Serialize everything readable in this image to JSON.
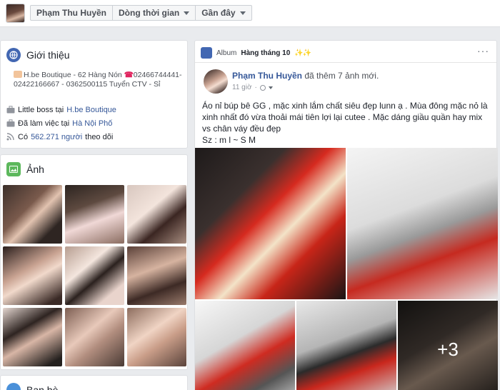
{
  "topbar": {
    "profile_name": "Phạm Thu Huyền",
    "timeline_label": "Dòng thời gian",
    "recent_label": "Gần đây"
  },
  "intro": {
    "title": "Giới thiệu",
    "bio_shop": "H.be Boutique - 62 Hàng Nón",
    "bio_phone": "02466744441-",
    "bio_rest": "02422166667 - 0362500115 Tuyển CTV - Sỉ",
    "work_prefix": "Little boss tại",
    "work_place": "H.be Boutique",
    "location_prefix": "Đã làm việc tại",
    "location_place": "Hà Nội Phố",
    "followers_prefix": "Có",
    "followers_count": "562.271 người",
    "followers_suffix": "theo dõi"
  },
  "photos": {
    "title": "Ảnh"
  },
  "friends": {
    "title": "Bạn bè"
  },
  "post": {
    "album_prefix": "Album",
    "album_name": "Hàng tháng 10",
    "album_emoji": "✨✨",
    "author": "Phạm Thu Huyền",
    "action": "đã thêm 7 ảnh mới.",
    "time": "11 giờ",
    "caption_1": "Áo nỉ búp bê GG , mặc xinh lắm chất siêu đẹp lunn ạ . Mùa đông mặc nỏ là xinh nhất đó vừa thoải mái tiên lợi lại cutee . Mặc dáng giầu quần hay mix vs chân váy đều đẹp",
    "caption_2": "Sz : m l ~ S M",
    "more_count": "+3"
  },
  "colors": {
    "link": "#365899",
    "accent": "#4267b2",
    "background": "#e9ebee"
  }
}
